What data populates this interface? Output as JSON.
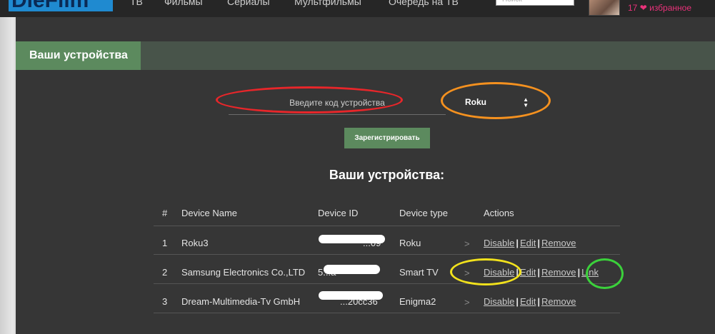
{
  "topbar": {
    "logo_text": "DieFilm",
    "nav": [
      "TB",
      "Фильмы",
      "Сериалы",
      "Мультфильмы",
      "Очередь на ТВ"
    ],
    "search_placeholder": "Поиск",
    "favorites_count": "17",
    "favorites_label": "избранное"
  },
  "section": {
    "title": "Ваши устройства"
  },
  "register_form": {
    "code_placeholder": "Введите код устройства",
    "device_select_value": "Roku",
    "register_label": "Зарегистрировать"
  },
  "devices": {
    "title": "Ваши устройства:",
    "columns": [
      "#",
      "Device Name",
      "Device ID",
      "Device type",
      "Actions"
    ],
    "rows": [
      {
        "num": "1",
        "name": "Roku3",
        "id_visible": "...09",
        "type": "Roku",
        "actions": [
          "Disable",
          "Edit",
          "Remove"
        ]
      },
      {
        "num": "2",
        "name": "Samsung Electronics Co.,LTD",
        "id_visible": "5...a",
        "type": "Smart TV",
        "actions": [
          "Disable",
          "Edit",
          "Remove",
          "Link"
        ]
      },
      {
        "num": "3",
        "name": "Dream-Multimedia-Tv GmbH",
        "id_visible": "...20cc36",
        "type": "Enigma2",
        "actions": [
          "Disable",
          "Edit",
          "Remove"
        ]
      }
    ],
    "row_arrow": ">"
  },
  "colors": {
    "accent_green": "#5c8a5e",
    "panel_bg": "#363636",
    "annotation_red": "#e8262a",
    "annotation_orange": "#f5911f",
    "annotation_yellow": "#f2e21c",
    "annotation_green": "#3bd13b"
  }
}
